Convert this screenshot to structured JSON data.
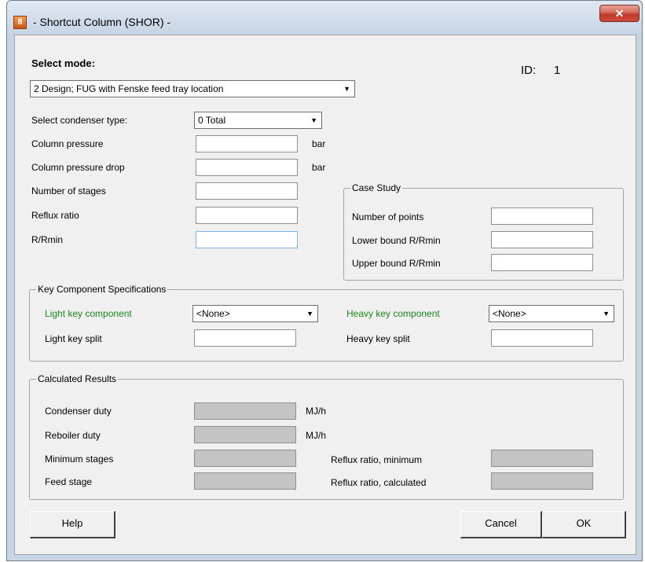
{
  "window": {
    "title": "- Shortcut Column (SHOR) -",
    "close_glyph": "✕"
  },
  "header": {
    "select_mode_label": "Select mode:",
    "id_label": "ID:",
    "id_value": "1"
  },
  "mode": {
    "selected": "2 Design; FUG with Fenske feed tray location"
  },
  "condenser": {
    "label": "Select condenser type:",
    "selected": "0 Total"
  },
  "fields": {
    "column_pressure": {
      "label": "Column pressure",
      "value": "",
      "unit": "bar"
    },
    "column_pressure_drop": {
      "label": "Column pressure drop",
      "value": "",
      "unit": "bar"
    },
    "number_of_stages": {
      "label": "Number of stages",
      "value": ""
    },
    "reflux_ratio": {
      "label": "Reflux ratio",
      "value": ""
    },
    "r_rmin": {
      "label": "R/Rmin",
      "value": ""
    }
  },
  "case_study": {
    "title": "Case Study",
    "number_of_points": {
      "label": "Number of points",
      "value": ""
    },
    "lower_bound": {
      "label": "Lower bound R/Rmin",
      "value": ""
    },
    "upper_bound": {
      "label": "Upper bound R/Rmin",
      "value": ""
    }
  },
  "key_components": {
    "title": "Key Component Specifications",
    "light_key_label": "Light key component",
    "light_key_selected": "<None>",
    "heavy_key_label": "Heavy key component",
    "heavy_key_selected": "<None>",
    "light_split_label": "Light key split",
    "light_split_value": "",
    "heavy_split_label": "Heavy key split",
    "heavy_split_value": "",
    "label_color": "#1a8a1a"
  },
  "results": {
    "title": "Calculated Results",
    "condenser_duty": {
      "label": "Condenser duty",
      "unit": "MJ/h"
    },
    "reboiler_duty": {
      "label": "Reboiler duty",
      "unit": "MJ/h"
    },
    "minimum_stages": {
      "label": "Minimum stages"
    },
    "feed_stage": {
      "label": "Feed stage"
    },
    "reflux_min": {
      "label": "Reflux ratio, minimum"
    },
    "reflux_calc": {
      "label": "Reflux ratio, calculated"
    }
  },
  "buttons": {
    "help": "Help",
    "cancel": "Cancel",
    "ok": "OK"
  }
}
